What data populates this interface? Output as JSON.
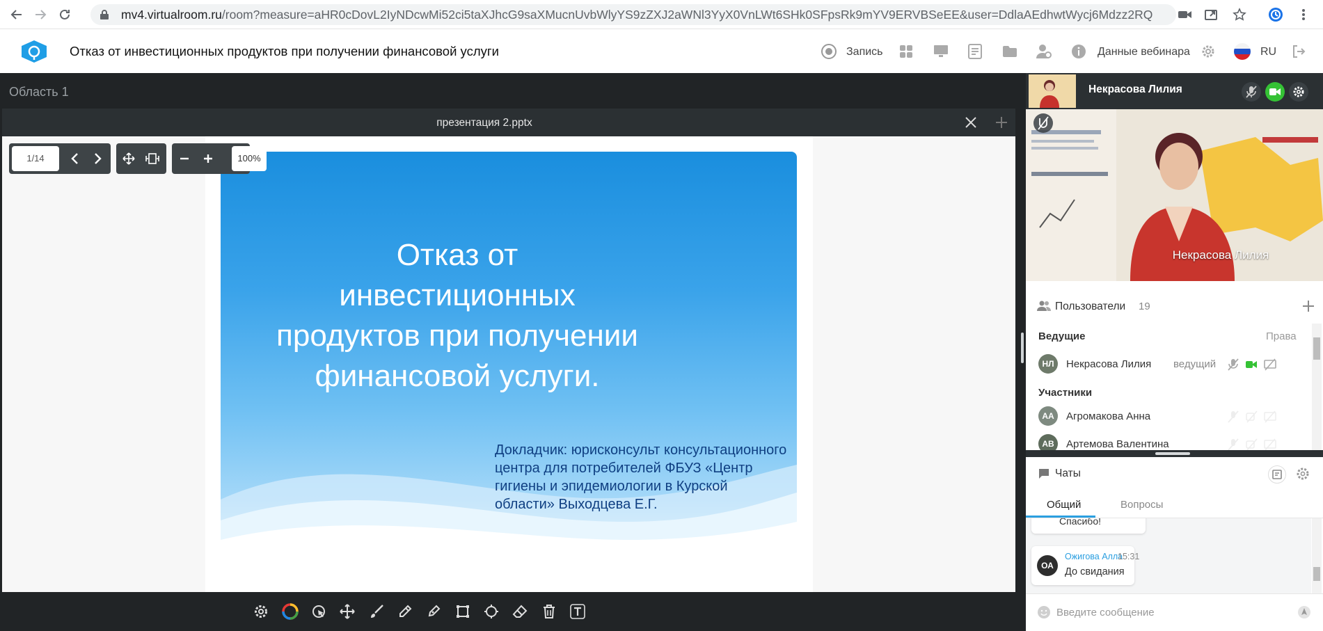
{
  "browser": {
    "url_host": "mv4.virtualroom.ru",
    "url_rest": "/room?measure=aHR0cDovL2IyNDcwMi52ci5taXJhcG9saXMucnUvbWlyYS9zZXJ2aWNl3YyX0VnLWt6SHk0SFpsRk9mYV9ERVBSeEE&user=DdlaAEdhwtWycj6Mdzz2RQ"
  },
  "header": {
    "title": "Отказ от инвестиционных продуктов при получении финансовой услуги",
    "record_label": "Запись",
    "webinar_data_label": "Данные вебинара",
    "lang": "RU"
  },
  "workspace": {
    "area_label": "Область 1",
    "presentation_title": "презентация 2.pptx",
    "page_indicator": "1/14",
    "zoom": "100%"
  },
  "slide": {
    "title": "Отказ от инвестиционных продуктов при получении финансовой услуги.",
    "subtitle": "Докладчик: юрисконсульт консультационного центра для потребителей ФБУЗ «Центр гигиены и эпидемиологии в Курской области» Выходцева Е.Г."
  },
  "video": {
    "presenter_name": "Некрасова Лилия",
    "overlay_name": "Некрасова Лилия"
  },
  "users": {
    "title": "Пользователи",
    "count": "19",
    "hosts_label": "Ведущие",
    "rights_label": "Права",
    "hosts": [
      {
        "initials": "НЛ",
        "name": "Некрасова Лилия",
        "role": "ведущий"
      }
    ],
    "participants_label": "Участники",
    "participants": [
      {
        "initials": "АА",
        "name": "Агромакова Анна"
      },
      {
        "initials": "АВ",
        "name": "Артемова Валентина"
      }
    ]
  },
  "chats": {
    "title": "Чаты",
    "tabs": [
      "Общий",
      "Вопросы"
    ],
    "messages": [
      {
        "text": "Спасибо!"
      },
      {
        "initials": "ОА",
        "author": "Ожигова Алла",
        "time": "15:31",
        "text": "До свидания"
      }
    ],
    "input_placeholder": "Введите сообщение"
  },
  "colors": {
    "accent_blue": "#2b9fe0",
    "camera_green": "#35c235",
    "dark_bg": "#212426"
  }
}
